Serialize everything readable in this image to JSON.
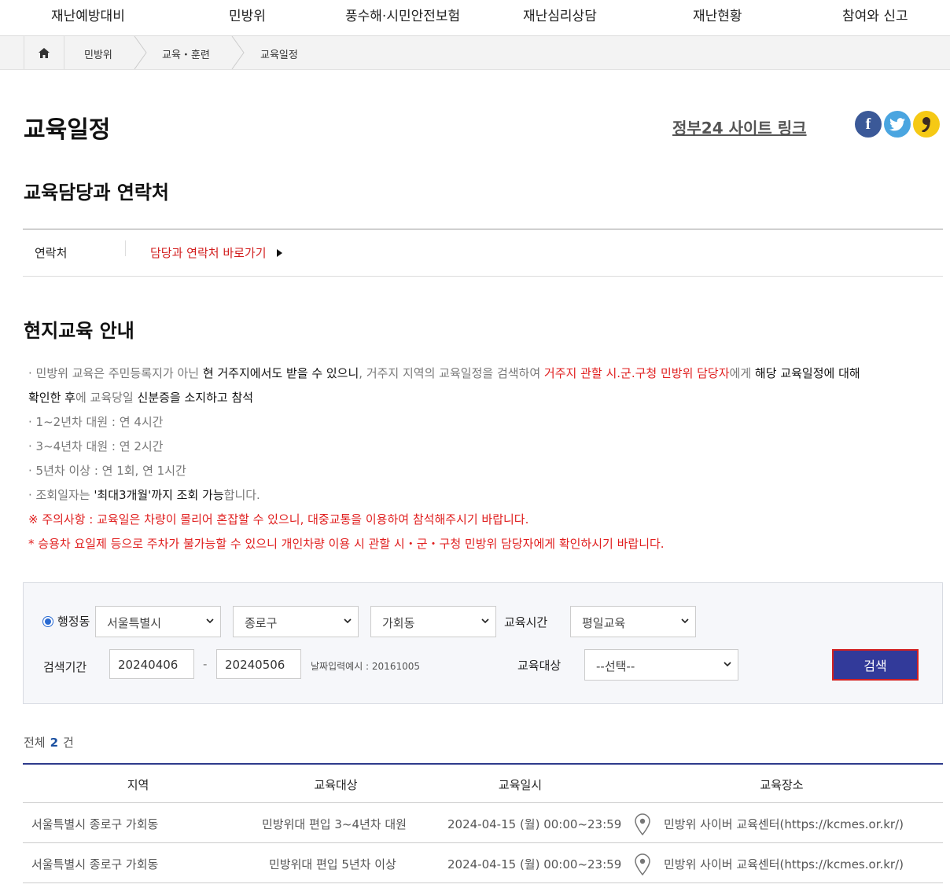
{
  "topnav": [
    "재난예방대비",
    "민방위",
    "풍수해·시민안전보험",
    "재난심리상담",
    "재난현황",
    "참여와 신고"
  ],
  "breadcrumb": {
    "home_icon": "home-icon",
    "items": [
      "민방위",
      "교육・훈련",
      "교육일정"
    ]
  },
  "page": {
    "title": "교육일정",
    "gov_link": "정부24 사이트 링크"
  },
  "sns": {
    "facebook": "f",
    "twitter": "twitter-icon",
    "kakaostory": "kakaostory-icon"
  },
  "contact_section": {
    "heading": "교육담당과 연락처",
    "label": "연락처",
    "link": "담당과 연락처 바로가기"
  },
  "notice_section": {
    "heading": "현지교육 안내",
    "p1": {
      "a": "· 민방위 교육은 주민등록지가 아닌 ",
      "b": "현 거주지에서도 받을 수 있으니",
      "c": ", 거주지 지역의 교육일정을 검색하여 ",
      "d": "거주지 관할 시.군.구청 민방위 담당자",
      "e": "에게 ",
      "f": "해당 교육일정",
      "g": "에 대해",
      "h": "확인한 후",
      "i": "에 교육당일 ",
      "j": "신분증을 소지하고 참석"
    },
    "l2": "· 1~2년차 대원 : 연 4시간",
    "l3": "· 3~4년차 대원 : 연 2시간",
    "l4": "· 5년차 이상 : 연 1회, 연 1시간",
    "l5": {
      "a": "· 조회일자는 ",
      "b": "'최대3개월'까지 조회 가능",
      "c": "합니다."
    },
    "warn1": "※ 주의사항 : 교육일은 차량이 몰리어 혼잡할 수 있으니, 대중교통을 이용하여 참석해주시기 바랍니다.",
    "warn2": "* 승용차 요일제 등으로 주차가 불가능할 수 있으니 개인차량 이용 시 관할 시・군・구청 민방위 담당자에게 확인하시기 바랍니다."
  },
  "search": {
    "radio_label": "행정동",
    "sido": "서울특별시",
    "sigungu": "종로구",
    "dong": "가회동",
    "time_label": "교육시간",
    "time_value": "평일교육",
    "period_label": "검색기간",
    "date_from": "20240406",
    "date_sep": "-",
    "date_to": "20240506",
    "date_hint": "날짜입력예시 : 20161005",
    "target_label": "교육대상",
    "target_value": "--선택--",
    "button": "검색"
  },
  "results": {
    "total_label": "전체",
    "total": "2",
    "unit": "건",
    "headers": [
      "지역",
      "교육대상",
      "교육일시",
      "교육장소"
    ],
    "rows": [
      {
        "region": "서울특별시 종로구 가회동",
        "target": "민방위대 편입 3~4년차 대원",
        "datetime": "2024-04-15 (월) 00:00~23:59",
        "place": "민방위 사이버 교육센터(https://kcmes.or.kr/)"
      },
      {
        "region": "서울특별시 종로구 가회동",
        "target": "민방위대 편입 5년차 이상",
        "datetime": "2024-04-15 (월) 00:00~23:59",
        "place": "민방위 사이버 교육센터(https://kcmes.or.kr/)"
      }
    ]
  }
}
